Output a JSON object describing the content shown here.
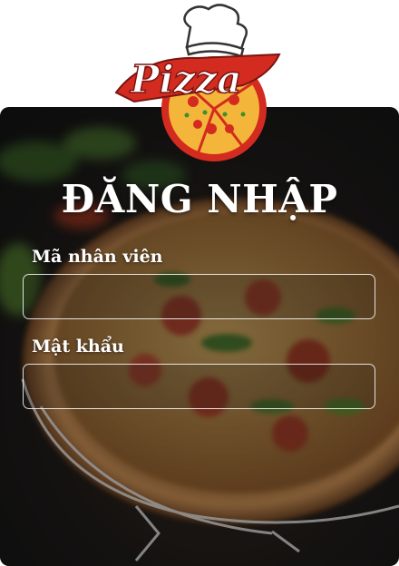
{
  "logo": {
    "text": "Pizza",
    "icon": "pizza-chef-hat-logo"
  },
  "login": {
    "title": "ĐĂNG NHẬP",
    "employee_id_label": "Mã nhân viên",
    "employee_id_value": "",
    "employee_id_placeholder": "",
    "password_label": "Mật khẩu",
    "password_value": "",
    "password_placeholder": ""
  },
  "colors": {
    "logo_red": "#d32b1f",
    "logo_cheese": "#f4b63a",
    "background_dark": "#1c1a18",
    "text": "#ffffff"
  }
}
